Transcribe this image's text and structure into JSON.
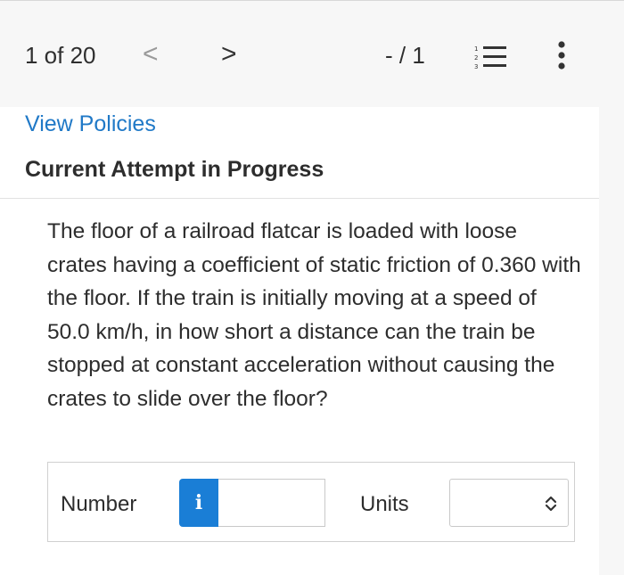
{
  "header": {
    "counter": "1 of 20",
    "prev_symbol": "<",
    "next_symbol": ">",
    "score": "- / 1",
    "list_icon": "numbered-list-icon",
    "more_icon": "more-vertical-icon"
  },
  "links": {
    "view_policies": "View Policies"
  },
  "status": {
    "attempt": "Current Attempt in Progress"
  },
  "question": {
    "text": "The floor of a railroad flatcar is loaded with loose crates having a coefficient of static friction of 0.360 with the floor. If the train is initially moving at a speed of 50.0 km/h, in how short a distance can the train be stopped at constant acceleration without causing the crates to slide over the floor?"
  },
  "answer": {
    "number_label": "Number",
    "info_symbol": "i",
    "number_value": "",
    "units_label": "Units",
    "units_value": ""
  },
  "colors": {
    "link": "#2079c7",
    "info_button": "#1a7ed6"
  }
}
